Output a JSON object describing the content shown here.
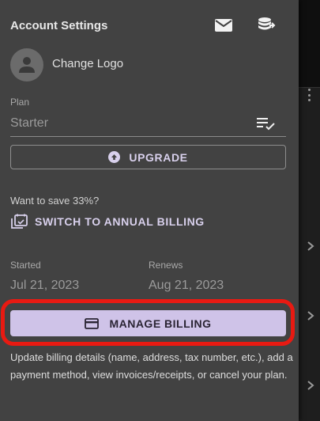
{
  "drawer": {
    "title": "Account Settings",
    "header_icons": [
      "mail-icon",
      "database-transfer-icon"
    ],
    "change_logo": "Change Logo",
    "plan": {
      "label": "Plan",
      "value": "Starter"
    },
    "upgrade_button": "UPGRADE",
    "save_text": "Want to save 33%?",
    "switch_link": "SWITCH TO ANNUAL BILLING",
    "started": {
      "label": "Started",
      "value": "Jul 21, 2023"
    },
    "renews": {
      "label": "Renews",
      "value": "Aug 21, 2023"
    },
    "manage_button": "MANAGE BILLING",
    "description": "Update billing details (name, address, tax number, etc.), add a payment method, view invoices/receipts, or cancel your plan."
  },
  "colors": {
    "drawer_bg": "#424242",
    "accent": "#cfc3e8",
    "highlight": "#e81a12"
  }
}
